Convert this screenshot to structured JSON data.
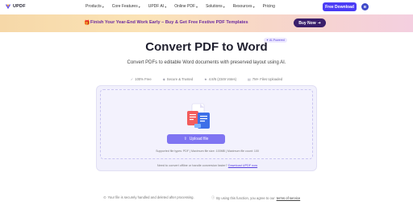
{
  "nav": {
    "logo_text": "UPDF",
    "menu": [
      {
        "label": "Products"
      },
      {
        "label": "Core Features"
      },
      {
        "label": "UPDF AI"
      },
      {
        "label": "Online PDF"
      },
      {
        "label": "Solutions"
      },
      {
        "label": "Resources"
      },
      {
        "label": "Pricing"
      }
    ],
    "download_label": "Free Download",
    "avatar_initial": "B"
  },
  "banner": {
    "text": "Finish Your Year-End Work Early – Buy & Get Free Festive PDF Templates",
    "buy_label": "Buy Now"
  },
  "hero": {
    "title": "Convert PDF to Word",
    "badge": "AI-Powered",
    "subtitle": "Convert PDFs to editable Word documents with preserved layout using AI."
  },
  "features": [
    {
      "label": "100% Free"
    },
    {
      "label": "Secure & Trusted"
    },
    {
      "label": "4.8/5 (2349 Votes)"
    },
    {
      "label": "7M+ Files Uploaded"
    }
  ],
  "upload": {
    "button_label": "Upload file",
    "limits": "Supported file types: PDF  |  Maximum file size: 100MB  |  Maximum file count: 100",
    "offline_text": "Need to convert offline or handle conversion faster?",
    "offline_link": "Download UPDF now"
  },
  "footer": {
    "security_note": "Your file is securely handled and deleted after processing.",
    "terms_prefix": "By using this function, you agree to our",
    "terms_link": "terms of service"
  },
  "colors": {
    "accent": "#4b3cf5",
    "upload_button": "#7f74f2",
    "panel_bg": "#f1f0fc"
  }
}
